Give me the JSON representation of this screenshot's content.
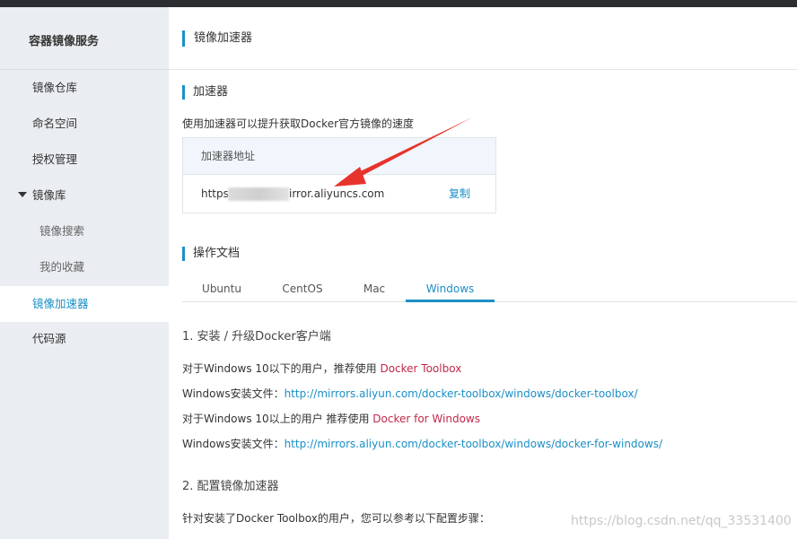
{
  "sidebar": {
    "title": "容器镜像服务",
    "items": [
      {
        "label": "镜像仓库"
      },
      {
        "label": "命名空间"
      },
      {
        "label": "授权管理"
      },
      {
        "label": "镜像库"
      },
      {
        "label": "镜像搜索"
      },
      {
        "label": "我的收藏"
      },
      {
        "label": "镜像加速器"
      },
      {
        "label": "代码源"
      }
    ],
    "active_item": "镜像加速器"
  },
  "main": {
    "page_title": "镜像加速器",
    "accelerator": {
      "section_title": "加速器",
      "description": "使用加速器可以提升获取Docker官方镜像的速度",
      "table_header": "加速器地址",
      "url_prefix": "https:",
      "url_suffix": "irror.aliyuncs.com",
      "copy_label": "复制"
    },
    "docs": {
      "section_title": "操作文档",
      "tabs": [
        {
          "label": "Ubuntu"
        },
        {
          "label": "CentOS"
        },
        {
          "label": "Mac"
        },
        {
          "label": "Windows"
        }
      ],
      "active_tab": "Windows",
      "step1_title": "1. 安装 / 升级Docker客户端",
      "lines": [
        {
          "text": "对于Windows 10以下的用户，推荐使用 ",
          "highlight": "Docker Toolbox"
        },
        {
          "text": "Windows安装文件：",
          "link": "http://mirrors.aliyun.com/docker-toolbox/windows/docker-toolbox/"
        },
        {
          "text": "对于Windows 10以上的用户 推荐使用 ",
          "highlight": "Docker for Windows"
        },
        {
          "text": "Windows安装文件：",
          "link": "http://mirrors.aliyun.com/docker-toolbox/windows/docker-for-windows/"
        }
      ],
      "step2_title": "2. 配置镜像加速器",
      "step2_text": "针对安装了Docker Toolbox的用户，您可以参考以下配置步骤："
    }
  },
  "watermark": "https://blog.csdn.net/qq_33531400",
  "colors": {
    "accent": "#1b8fc6",
    "highlight_red": "#c1284a",
    "arrow_red": "#e8322c",
    "sidebar_bg": "#eaedf1"
  }
}
